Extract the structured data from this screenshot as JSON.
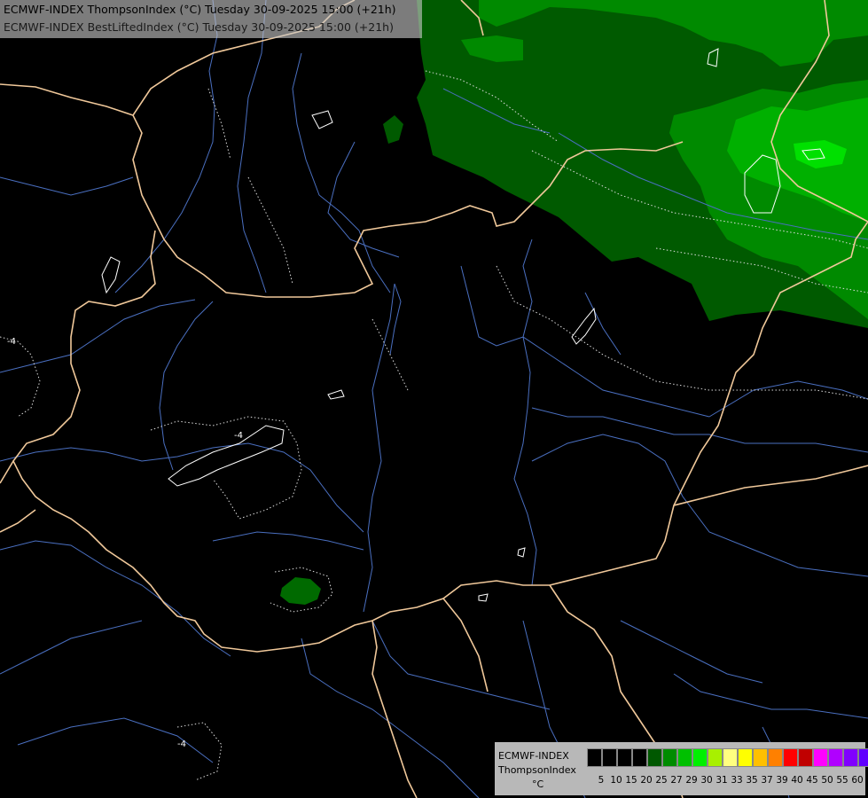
{
  "header": {
    "line1": "ECMWF-INDEX ThompsonIndex (°C) Tuesday 30-09-2025 15:00 (+21h)",
    "line2": "ECMWF-INDEX BestLiftedIndex (°C) Tuesday 30-09-2025 15:00 (+21h)"
  },
  "legend": {
    "title_line1": "ECMWF-INDEX",
    "title_line2": "ThompsonIndex",
    "unit": "°C",
    "ticks": [
      "5",
      "10",
      "15",
      "20",
      "25",
      "27",
      "29",
      "30",
      "31",
      "33",
      "35",
      "37",
      "39",
      "40",
      "45",
      "50",
      "55",
      "60"
    ],
    "colors": [
      "#000000",
      "#000000",
      "#000000",
      "#000000",
      "#005800",
      "#008c00",
      "#00c000",
      "#00f000",
      "#a8f000",
      "#ffff80",
      "#ffff00",
      "#ffc000",
      "#ff8000",
      "#ff0000",
      "#c00000",
      "#ff00ff",
      "#b000ff",
      "#8000ff",
      "#6000ff",
      "#0000ff"
    ]
  },
  "map": {
    "contour_labels": [
      "-4",
      "-4",
      "-4"
    ],
    "colors": {
      "background": "#000000",
      "border": "#f0c89a",
      "river": "#4a6fc0",
      "shade_dark": "#005a00",
      "shade_mid": "#008a00",
      "shade_light": "#00b000",
      "shade_bright": "#00e000"
    }
  }
}
